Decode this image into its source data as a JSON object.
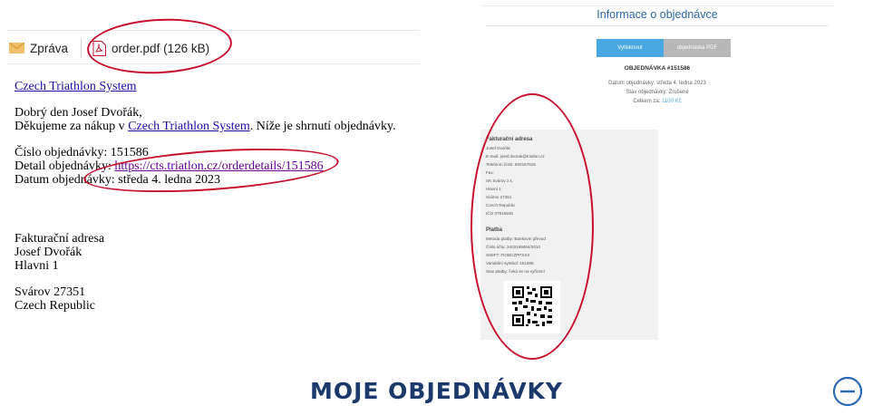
{
  "email": {
    "tabs": {
      "message_label": "Zpráva",
      "attachment_label": "order.pdf (126 kB)"
    },
    "body": {
      "sender_link": "Czech Triathlon System",
      "greeting": "Dobrý den Josef Dvořák,",
      "thanks_prefix": "Děkujeme za nákup v ",
      "thanks_link": "Czech Triathlon System",
      "thanks_suffix": ". Níže je shrnutí objednávky.",
      "order_number_line": "Číslo objednávky: 151586",
      "detail_prefix": "Detail objednávky: ",
      "detail_link": "https://cts.triatlon.cz/orderdetails/151586",
      "date_line": "Datum objednávky: středa 4. ledna 2023",
      "billing_title": "Fakturační adresa",
      "billing_name": "Josef Dvořák",
      "billing_street": "Hlavni 1",
      "billing_city": "Svárov 27351",
      "billing_country": "Czech Republic"
    }
  },
  "detail": {
    "title": "Informace o objednávce",
    "print_button": "Vytisknout",
    "pdf_button": "objednávka PDF",
    "order_heading": "OBJEDNÁVKA #151586",
    "date_line": "Datum objednávky: středa 4. ledna 2023",
    "status_line": "Stav objednávky: Zrušené",
    "total_prefix": "Celkem za: ",
    "total_amount": "1100 Kč",
    "billing": {
      "title": "Fakturační adresa",
      "lines": [
        "Josef Dvořák",
        "E-mail: josef.dvorak@triatlon.cz",
        "Telefonní číslo: 603157815",
        "Fax:",
        "SK Svárov z.s.",
        "Hlavní 1",
        "Svárov 27351",
        "Czech Republic",
        "IČO 07915845"
      ]
    },
    "payment": {
      "title": "Platba",
      "lines": [
        "Metoda platby: Bankovní převod",
        "Číslo účtu: 2403169854/2010",
        "SWIFT: FIOBCZPPXXX",
        "Variabilní symbol: 151586",
        "Stav platby: čeká se na vyřízení"
      ]
    }
  },
  "footer": {
    "heading": "MOJE OBJEDNÁVKY"
  },
  "colors": {
    "link": "#1a0dab",
    "visited_link": "#660099",
    "annotation": "#c8102e",
    "heading_navy": "#1b3a6b",
    "accent_blue": "#49a8e2"
  }
}
